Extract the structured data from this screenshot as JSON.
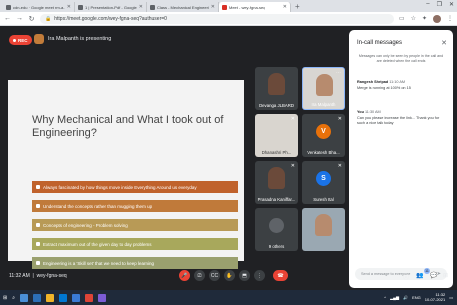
{
  "browser": {
    "tabs": [
      {
        "label": "cdn-edu · Google meet rm-a...",
        "active": false
      },
      {
        "label": "1 | Presentation-Pdf - Google doc...",
        "active": false
      },
      {
        "label": "Class - Mechanical Engineering...",
        "active": false
      },
      {
        "label": "Meet - wey-fgna-seq",
        "active": true
      }
    ],
    "new_tab": "+",
    "window_controls": [
      "–",
      "❐",
      "✕"
    ],
    "url": "https://meet.google.com/wey-fgna-seq?authuser=0",
    "nav": {
      "back": "←",
      "forward": "→",
      "reload": "↻"
    }
  },
  "meet": {
    "rec_label": "REC",
    "presenting_text": "Ira Malpanth is presenting",
    "slide": {
      "title": "Why Mechanical and What I took out of Engineering?",
      "bullets": [
        "Always fascinated by how things move inside Everything Around us everyday",
        "Understand the concepts rather than mugging them up",
        "Concepts of engineering - Problem solving",
        "Extract maximum out of the given day to day problems",
        "Engineering is a 'Skill set' that we need to keep learning"
      ]
    },
    "participants": [
      {
        "name": "Devanga JLBARD",
        "initial": "",
        "color": "",
        "mic": ""
      },
      {
        "name": "Ira Malpanth",
        "initial": "",
        "color": "",
        "mic": "⋯"
      },
      {
        "name": "Dhanashri Ph...",
        "initial": "",
        "color": "",
        "mic": "✕"
      },
      {
        "name": "Venkatesh Bha...",
        "initial": "V",
        "color": "#e8710a",
        "mic": "✕"
      },
      {
        "name": "Prasadna Kaniffar...",
        "initial": "",
        "color": "",
        "mic": "✕"
      },
      {
        "name": "Suresh Ital",
        "initial": "S",
        "color": "#1a73e8",
        "mic": "✕"
      },
      {
        "name": "9 others",
        "initial": "",
        "color": "",
        "mic": ""
      },
      {
        "name": "You",
        "initial": "",
        "color": "",
        "mic": ""
      }
    ],
    "clock": "11:32 AM",
    "meeting_code": "wey-fgna-seq",
    "controls": [
      "🎤",
      "⎚",
      "CC",
      "✋",
      "⬒",
      "⋮"
    ],
    "right_controls": [
      "ⓘ",
      "👥",
      "💬",
      "⊞"
    ],
    "people_count": "11",
    "chat": {
      "title": "In-call messages",
      "close": "✕",
      "note": "Messages can only be seen by people in the call and are deleted when the call ends",
      "messages": [
        {
          "sender": "Rangesh Shripad",
          "time": "11:10 AM",
          "text": "Merge is running at 100% on 15"
        },
        {
          "sender": "You",
          "time": "11:30 AM",
          "text": "Can you please increase the link... Thank you for such a nice talk today"
        }
      ],
      "input_placeholder": "Send a message to everyone",
      "send_icon": "➤"
    }
  },
  "taskbar": {
    "tray": {
      "lang": "ENG",
      "time": "11:32",
      "date": "10-07-2021"
    }
  }
}
